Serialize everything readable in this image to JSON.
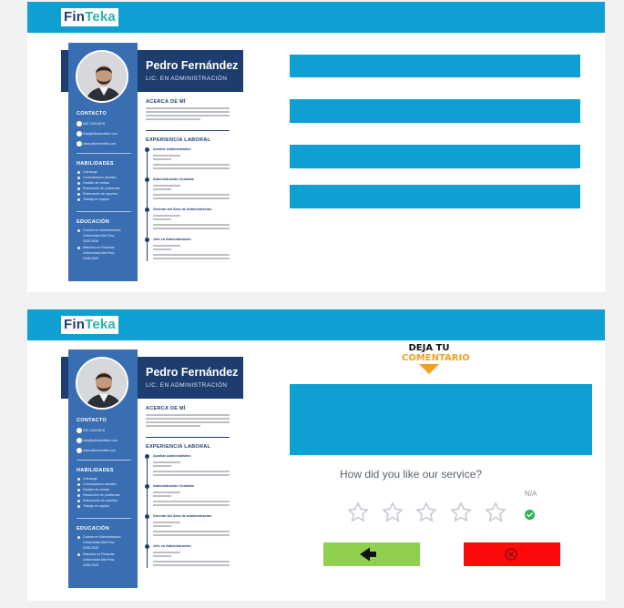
{
  "brand": {
    "logo_fin": "Fin",
    "logo_teka": "Teka"
  },
  "cv": {
    "name": "Pedro Fernández",
    "title": "LIC. EN ADMINISTRACIÓN",
    "sections": {
      "contact": "CONTACTO",
      "skills": "HABILIDADES",
      "education": "EDUCACIÓN",
      "about": "ACERCA DE MÍ",
      "experience": "EXPERIENCIA LABORAL"
    },
    "contact_items": [
      "000 1234-5678",
      "hola@sitioincreible.com",
      "www.sitioincreible.com"
    ],
    "skills": [
      "Liderazgo",
      "Comunicación asertiva",
      "Gestión de ventas",
      "Resolución de problemas",
      "Elaboración de reportes",
      "Trabajo en equipo"
    ],
    "education": [
      "Carrera en Administración",
      "Universidad Alta Prau",
      "2005-2008",
      "Maestría en Finanzas",
      "Universidad Alta Prau",
      "2008-2009"
    ],
    "jobs": [
      "Auxiliar Administrativo",
      "Administración Contable",
      "Gerente del Área de Administración",
      "Jefe en Administración"
    ]
  },
  "feedback": {
    "heading_line1": "DEJA TU",
    "heading_line2": "COMENTARIO",
    "question": "How did you like our service?",
    "na_label": "N/A",
    "back_icon": "arrow-left-icon",
    "close_icon": "close-circle-icon",
    "colors": {
      "accent": "#0fa0d3",
      "back_button": "#8fd14f",
      "close_button": "#ff0a0a",
      "check": "#2eb34f"
    }
  }
}
